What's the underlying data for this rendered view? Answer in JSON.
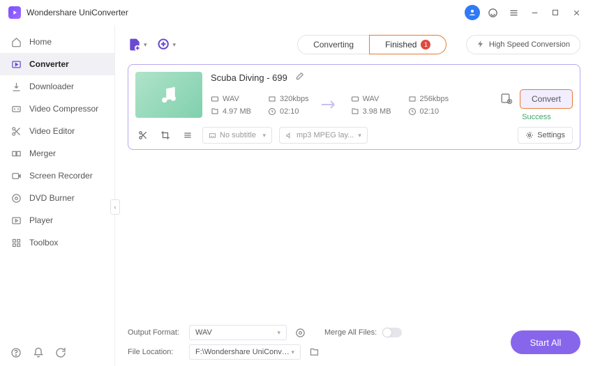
{
  "app": {
    "title": "Wondershare UniConverter"
  },
  "sidebar": {
    "items": [
      {
        "label": "Home"
      },
      {
        "label": "Converter"
      },
      {
        "label": "Downloader"
      },
      {
        "label": "Video Compressor"
      },
      {
        "label": "Video Editor"
      },
      {
        "label": "Merger"
      },
      {
        "label": "Screen Recorder"
      },
      {
        "label": "DVD Burner"
      },
      {
        "label": "Player"
      },
      {
        "label": "Toolbox"
      }
    ]
  },
  "toolbar": {
    "tabs": {
      "converting": "Converting",
      "finished": "Finished",
      "finished_count": "1"
    },
    "high_speed": "High Speed Conversion"
  },
  "file": {
    "title": "Scuba Diving - 699",
    "src": {
      "format": "WAV",
      "bitrate": "320kbps",
      "size": "4.97 MB",
      "duration": "02:10"
    },
    "dst": {
      "format": "WAV",
      "bitrate": "256kbps",
      "size": "3.98 MB",
      "duration": "02:10"
    },
    "convert_label": "Convert",
    "status": "Success",
    "subtitle_dd": "No subtitle",
    "audio_dd": "mp3 MPEG lay...",
    "settings_label": "Settings"
  },
  "footer": {
    "output_format_label": "Output Format:",
    "output_format_value": "WAV",
    "file_location_label": "File Location:",
    "file_location_value": "F:\\Wondershare UniConverter",
    "merge_label": "Merge All Files:",
    "start_all": "Start All"
  }
}
